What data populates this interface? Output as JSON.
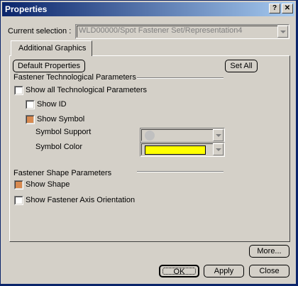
{
  "window": {
    "title": "Properties"
  },
  "titlebar": {
    "help_glyph": "?",
    "close_glyph": "✕"
  },
  "selection": {
    "label": "Current selection :",
    "value": "WLD00000/Spot Fastener Set/Representation4"
  },
  "tabs": [
    {
      "label": "Additional Graphics"
    }
  ],
  "buttons": {
    "default_properties": "Default Properties",
    "set_all": "Set All",
    "more": "More...",
    "ok": "OK",
    "apply": "Apply",
    "close": "Close"
  },
  "tech_params": {
    "header": "Fastener Technological Parameters",
    "show_all": {
      "label": "Show all Technological Parameters",
      "checked": false
    },
    "show_id": {
      "label": "Show ID",
      "checked": false
    },
    "show_symbol": {
      "label": "Show Symbol",
      "checked": true
    },
    "symbol_support": {
      "label": "Symbol Support"
    },
    "symbol_color": {
      "label": "Symbol Color",
      "color": "#ffff00"
    }
  },
  "shape_params": {
    "header": "Fastener Shape Parameters",
    "show_shape": {
      "label": "Show Shape",
      "checked": true
    },
    "show_axis": {
      "label": "Show Fastener Axis Orientation",
      "checked": false
    }
  }
}
